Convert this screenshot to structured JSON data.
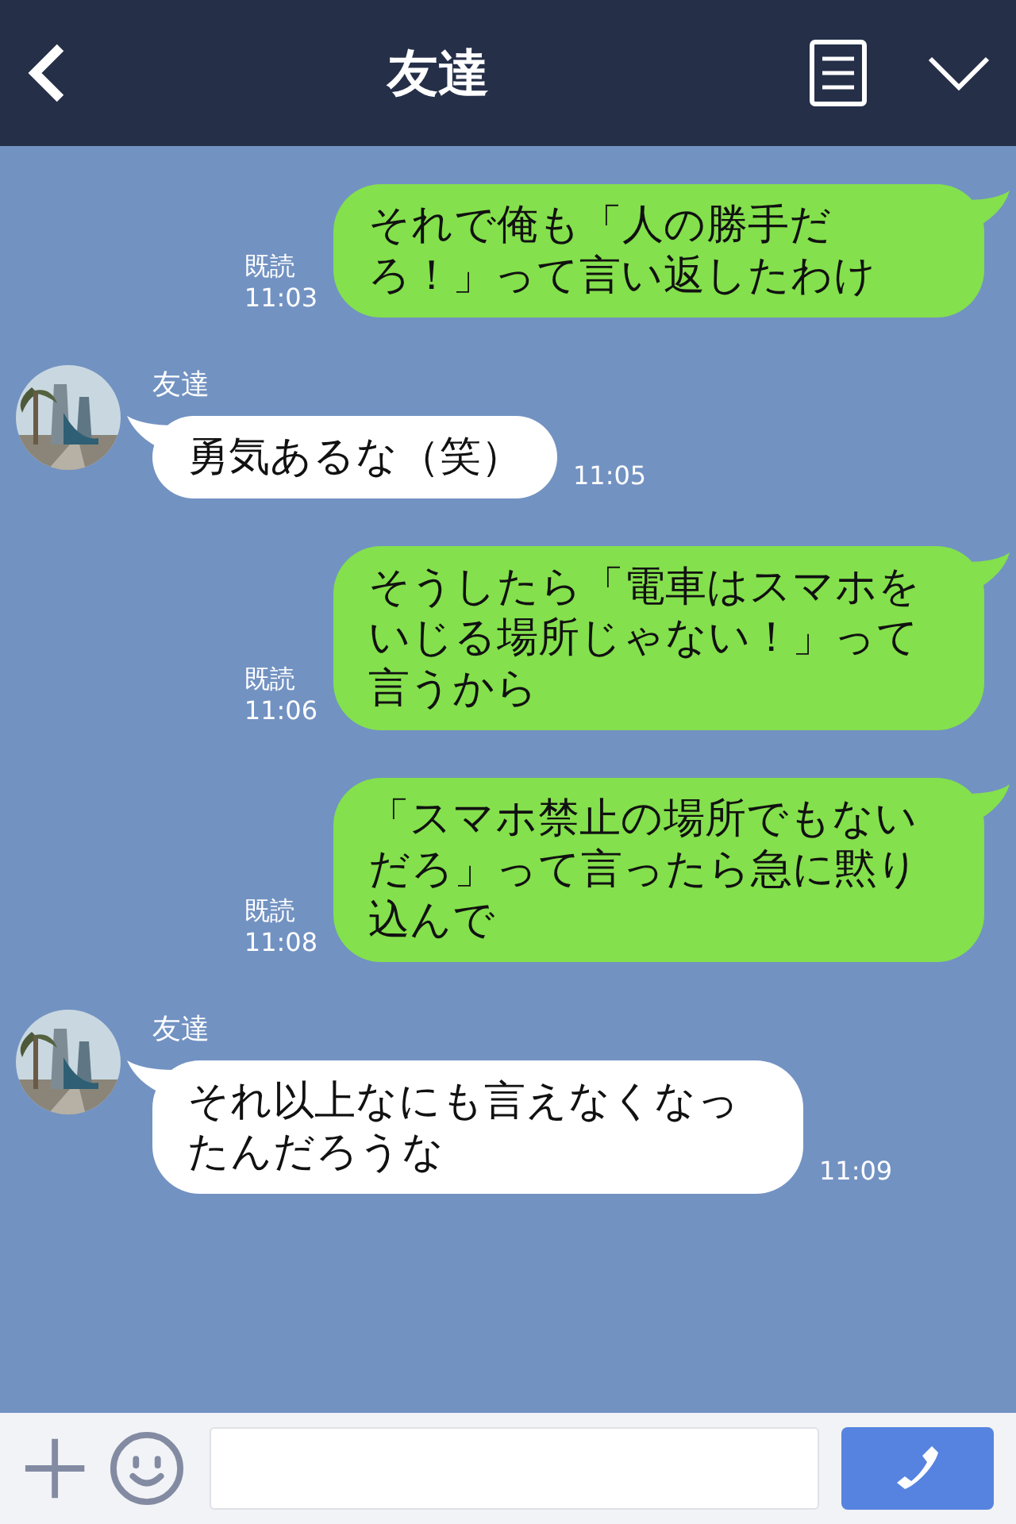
{
  "header": {
    "title": "友達"
  },
  "messages": [
    {
      "kind": "sent",
      "text": "それで俺も「人の勝手だろ！」って言い返したわけ",
      "read": "既読",
      "time": "11:03"
    },
    {
      "kind": "received",
      "sender": "友達",
      "text": "勇気あるな（笑）",
      "time": "11:05"
    },
    {
      "kind": "sent",
      "text": "そうしたら「電車はスマホをいじる場所じゃない！」って言うから",
      "read": "既読",
      "time": "11:06"
    },
    {
      "kind": "sent",
      "text": "「スマホ禁止の場所でもないだろ」って言ったら急に黙り込んで",
      "read": "既読",
      "time": "11:08"
    },
    {
      "kind": "received",
      "sender": "友達",
      "text": "それ以上なにも言えなくなったんだろうな",
      "time": "11:09"
    }
  ]
}
